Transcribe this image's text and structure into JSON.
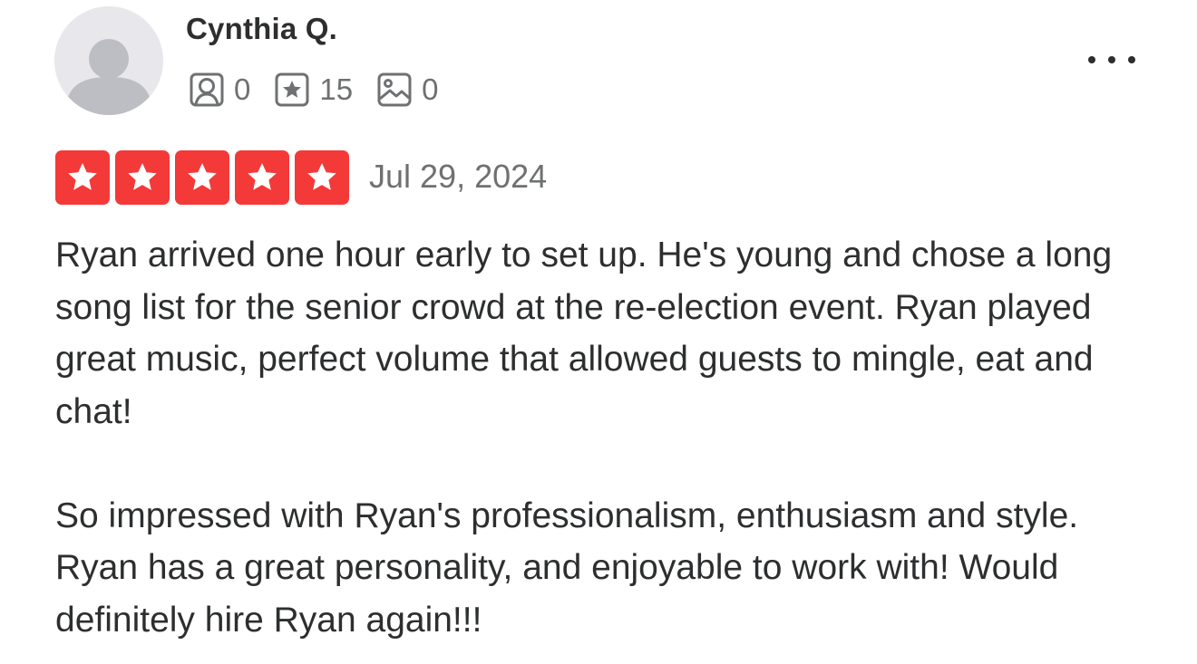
{
  "review": {
    "author": {
      "name": "Cynthia Q.",
      "avatar_icon": "default-user-avatar-icon"
    },
    "stats": {
      "friends": {
        "icon": "friends-icon",
        "value": "0"
      },
      "reviews": {
        "icon": "review-star-icon",
        "value": "15"
      },
      "photos": {
        "icon": "photo-icon",
        "value": "0"
      }
    },
    "rating": {
      "stars": 5,
      "max_stars": 5,
      "color": "#f43939"
    },
    "date": "Jul 29, 2024",
    "paragraphs": [
      "Ryan arrived one hour early to set up.  He's young and chose a long song list for the senior crowd at the re-election event.  Ryan played great music, perfect volume that allowed guests to mingle, eat and chat!",
      "So impressed with Ryan's professionalism, enthusiasm and style.  Ryan has a great personality, and enjoyable to work with!  Would definitely hire Ryan again!!!"
    ],
    "menu_icon": "more-options-icon"
  }
}
